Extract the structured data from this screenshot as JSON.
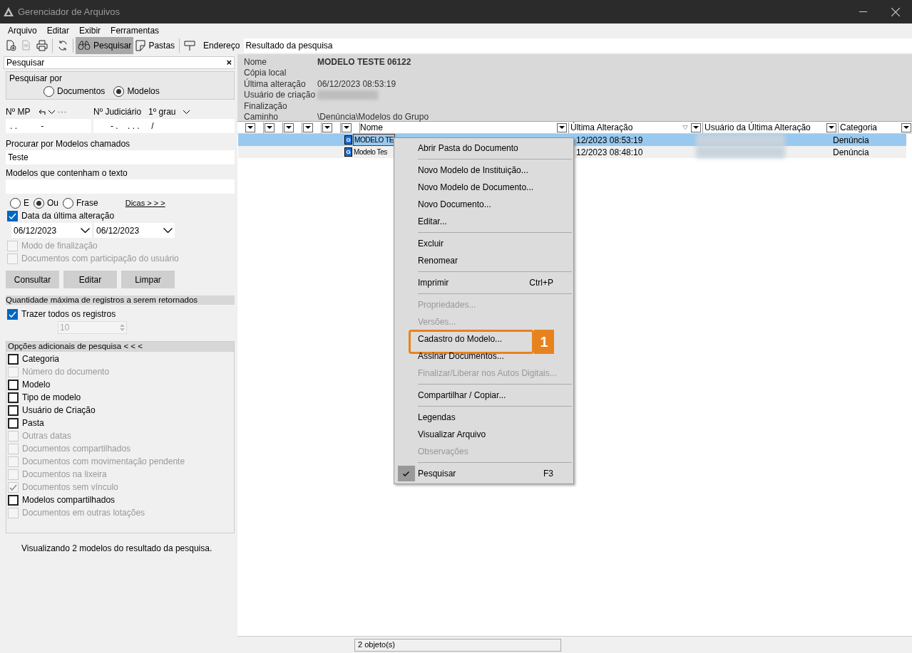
{
  "window": {
    "title": "Gerenciador de Arquivos"
  },
  "menu_bar": [
    "Arquivo",
    "Editar",
    "Exibir",
    "Ferramentas"
  ],
  "toolbar": {
    "buttons": [
      {
        "kind": "new-doc",
        "disabled": false,
        "selected": false
      },
      {
        "kind": "copy",
        "disabled": true,
        "selected": false
      },
      {
        "kind": "print",
        "disabled": false,
        "selected": false
      },
      {
        "kind": "refresh",
        "disabled": false,
        "selected": false
      },
      {
        "kind": "search",
        "label": "Pesquisar",
        "disabled": false,
        "selected": true
      },
      {
        "kind": "folder",
        "label": "Pastas",
        "disabled": false,
        "selected": false
      },
      {
        "kind": "pin",
        "disabled": false,
        "selected": false
      }
    ],
    "address_label": "Endereço",
    "address": "Resultado da pesquisa"
  },
  "search_panel": {
    "title": "Pesquisar",
    "close": "×",
    "search_by": {
      "label": "Pesquisar por",
      "options": [
        {
          "label": "Documentos",
          "selected": false
        },
        {
          "label": "Modelos",
          "selected": true
        }
      ]
    },
    "mp": {
      "label": "Nº MP",
      "value": ". .          -"
    },
    "judicial": {
      "label": "Nº Judiciário",
      "grade": "1º grau",
      "value": "- .    . . .     /"
    },
    "name_field": {
      "label": "Procurar por Modelos chamados",
      "value": "Teste"
    },
    "text_field": {
      "label": "Modelos que contenham o texto"
    },
    "match": [
      {
        "label": "E",
        "selected": false
      },
      {
        "label": "Ou",
        "selected": true
      },
      {
        "label": "Frase",
        "selected": false
      }
    ],
    "tips_link": "Dicas > > >",
    "date_filter": {
      "label": "Data da última alteração",
      "checked": true,
      "from": "06/12/2023",
      "to": "06/12/2023"
    },
    "options": [
      {
        "label": "Modo de finalização",
        "checked": false,
        "disabled": true
      },
      {
        "label": "Documentos com participação do usuário",
        "checked": false,
        "disabled": true
      }
    ],
    "buttons": [
      "Consultar",
      "Editar",
      "Limpar"
    ],
    "max_section": {
      "title": "Quantidade máxima de registros a serem retornados",
      "all": {
        "label": "Trazer todos os registros",
        "checked": true
      },
      "count": "10"
    },
    "extra_section": {
      "title": "Opções adicionais de pesquisa < < <",
      "items": [
        {
          "label": "Categoria",
          "checked": false,
          "disabled": false
        },
        {
          "label": "Número do documento",
          "checked": false,
          "disabled": true
        },
        {
          "label": "Modelo",
          "checked": false,
          "disabled": false
        },
        {
          "label": "Tipo de modelo",
          "checked": false,
          "disabled": false
        },
        {
          "label": "Usuário de Criação",
          "checked": false,
          "disabled": false
        },
        {
          "label": "Pasta",
          "checked": false,
          "disabled": false
        },
        {
          "label": "Outras datas",
          "checked": false,
          "disabled": true
        },
        {
          "label": "Documentos compartilhados",
          "checked": false,
          "disabled": true
        },
        {
          "label": "Documentos com movimentação pendente",
          "checked": false,
          "disabled": true
        },
        {
          "label": "Documentos na lixeira",
          "checked": false,
          "disabled": true
        },
        {
          "label": "Documentos sem vínculo",
          "checked": true,
          "disabled": true
        },
        {
          "label": "Modelos compartilhados",
          "checked": false,
          "disabled": false
        },
        {
          "label": "Documentos em outras lotações",
          "checked": false,
          "disabled": true
        }
      ]
    },
    "summary": "Visualizando 2 modelos do resultado da pesquisa."
  },
  "details": [
    {
      "label": "Nome",
      "value": "MODELO TESTE 06122",
      "kind": "bold"
    },
    {
      "label": "Cópia local",
      "kind": "text"
    },
    {
      "label": "Última alteração",
      "value": "06/12/2023 08:53:19",
      "kind": "text"
    },
    {
      "label": "Usuário de criação",
      "kind": "redacted"
    },
    {
      "label": "Finalização",
      "kind": "text"
    },
    {
      "label": "Caminho",
      "value": "\\Denúncia\\Modelos do Grupo",
      "kind": "text"
    }
  ],
  "table": {
    "columns": [
      "Nome",
      "Última Alteração",
      "Usuário da Última Alteração",
      "Categoria"
    ],
    "rows": [
      {
        "icon": "G",
        "name": "MODELO TE",
        "date": "12/2023 08:53:19",
        "category": "Denúncia",
        "selected": true
      },
      {
        "icon": "G",
        "name": "Modelo Tes",
        "date": "12/2023 08:48:10",
        "category": "Denúncia",
        "selected": false
      }
    ]
  },
  "context_menu": [
    {
      "kind": "item",
      "label": "Abrir Pasta do Documento",
      "disabled": false
    },
    {
      "kind": "separator"
    },
    {
      "kind": "item",
      "label": "Novo Modelo de Instituição...",
      "disabled": false
    },
    {
      "kind": "item",
      "label": "Novo Modelo de Documento...",
      "disabled": false
    },
    {
      "kind": "item",
      "label": "Novo Documento...",
      "disabled": false
    },
    {
      "kind": "item",
      "label": "Editar...",
      "disabled": false
    },
    {
      "kind": "separator"
    },
    {
      "kind": "item",
      "label": "Excluir",
      "disabled": false
    },
    {
      "kind": "item",
      "label": "Renomear",
      "disabled": false
    },
    {
      "kind": "separator"
    },
    {
      "kind": "item",
      "label": "Imprimir",
      "shortcut": "Ctrl+P",
      "disabled": false
    },
    {
      "kind": "separator"
    },
    {
      "kind": "item",
      "label": "Propriedades...",
      "disabled": true
    },
    {
      "kind": "item",
      "label": "Versões...",
      "disabled": true
    },
    {
      "kind": "item",
      "label": "Cadastro do Modelo...",
      "disabled": false,
      "callout": "1"
    },
    {
      "kind": "item",
      "label": "Assinar Documentos...",
      "disabled": false
    },
    {
      "kind": "item",
      "label": "Finalizar/Liberar nos Autos Digitais...",
      "disabled": true
    },
    {
      "kind": "separator"
    },
    {
      "kind": "item",
      "label": "Compartilhar / Copiar...",
      "disabled": false
    },
    {
      "kind": "separator"
    },
    {
      "kind": "item",
      "label": "Legendas",
      "disabled": false
    },
    {
      "kind": "item",
      "label": "Visualizar Arquivo",
      "disabled": false
    },
    {
      "kind": "item",
      "label": "Observações",
      "disabled": true
    },
    {
      "kind": "separator"
    },
    {
      "kind": "item",
      "label": "Pesquisar",
      "shortcut": "F3",
      "disabled": false,
      "checked": true
    }
  ],
  "status_bar": {
    "count": "2 objeto(s)"
  }
}
